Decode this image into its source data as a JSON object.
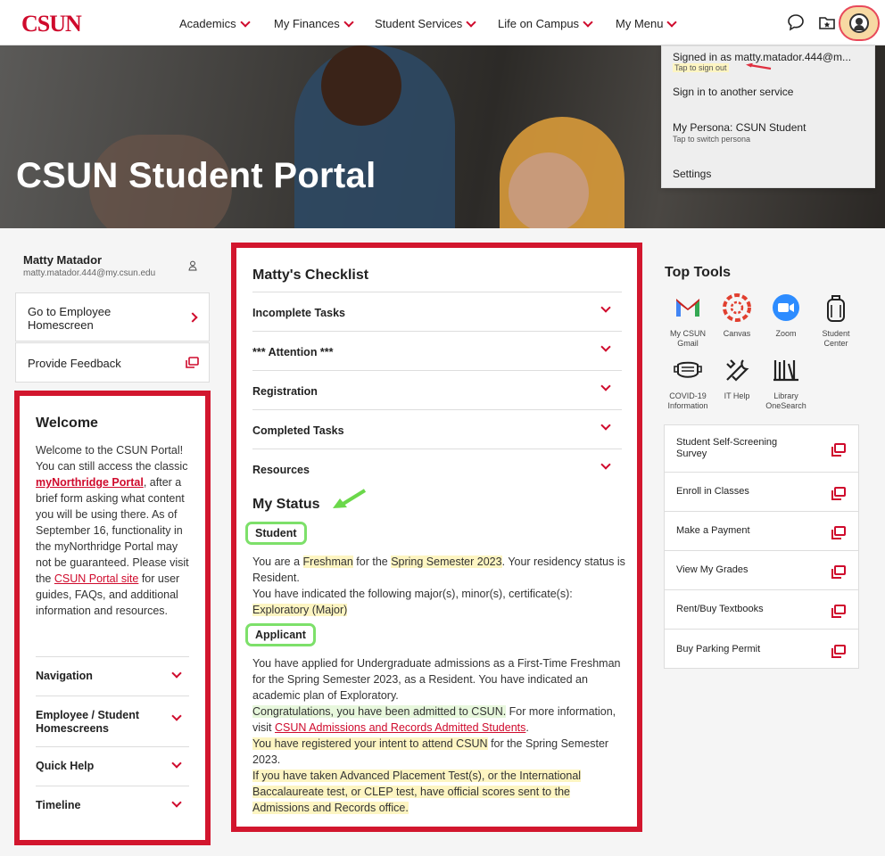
{
  "header": {
    "logo": "CSUN",
    "nav": [
      "Academics",
      "My Finances",
      "Student Services",
      "Life on Campus",
      "My Menu"
    ]
  },
  "hero": {
    "title": "CSUN Student Portal"
  },
  "account_menu": {
    "signed_in": "Signed in as matty.matador.444@m...",
    "sign_out_hint": "Tap to sign out",
    "another_service": "Sign in to another service",
    "persona": "My Persona: CSUN Student",
    "persona_hint": "Tap to switch persona",
    "settings": "Settings"
  },
  "user": {
    "name": "Matty Matador",
    "email": "matty.matador.444@my.csun.edu"
  },
  "left_buttons": {
    "employee": "Go to Employee Homescreen",
    "feedback": "Provide Feedback"
  },
  "welcome": {
    "title": "Welcome",
    "text1": "Welcome to the CSUN Portal! You can still access the classic ",
    "link1": "myNorthridge Portal",
    "text2": ", after a brief form asking what content you will be using there. As of September 16, functionality in the myNorthridge Portal may not be guaranteed. Please visit the ",
    "link2": "CSUN Portal site",
    "text3": " for user guides, FAQs, and additional information and resources.",
    "sections": [
      "Navigation",
      "Employee / Student Homescreens",
      "Quick Help",
      "Timeline"
    ]
  },
  "checklist": {
    "title": "Matty's Checklist",
    "rows": [
      "Incomplete Tasks",
      "*** Attention ***",
      "Registration",
      "Completed Tasks",
      "Resources"
    ]
  },
  "status": {
    "title": "My Status",
    "student_tag": "Student",
    "s1": "You are a ",
    "s_level": "Freshman",
    "s2": " for the ",
    "s_term": "Spring Semester 2023",
    "s3": ". Your residency status is Resident.",
    "s4": "You have indicated the following major(s), minor(s), certificate(s):",
    "s_major": "Exploratory (Major)",
    "applicant_tag": "Applicant",
    "a1": "You have applied for Undergraduate admissions as a First-Time Freshman for the Spring Semester 2023, as a Resident. You have indicated an academic plan of Exploratory.",
    "a_admit": "Congratulations, you have been admitted to CSUN.",
    "a2": " For more information, visit ",
    "a_link": "CSUN Admissions and Records Admitted Students",
    "a3": ".",
    "a_intent": "You have registered your intent to attend CSUN",
    "a4": " for the Spring Semester 2023.",
    "a_ap": "If you have taken Advanced Placement Test(s), or the International Baccalaureate test, or CLEP test, have official scores sent to the Admissions and Records office."
  },
  "top_tools": {
    "title": "Top Tools",
    "tools": [
      "My CSUN Gmail",
      "Canvas",
      "Zoom",
      "Student Center",
      "COVID-19 Information",
      "IT Help",
      "Library OneSearch"
    ],
    "links": [
      "Student Self-Screening Survey",
      "Enroll in Classes",
      "Make a Payment",
      "View My Grades",
      "Rent/Buy Textbooks",
      "Buy Parking Permit"
    ]
  },
  "colors": {
    "brand": "#cf0a2c",
    "annotation_red": "#d2162e",
    "annotation_green": "#7de06a",
    "highlight_yellow": "#fdf5c2"
  }
}
